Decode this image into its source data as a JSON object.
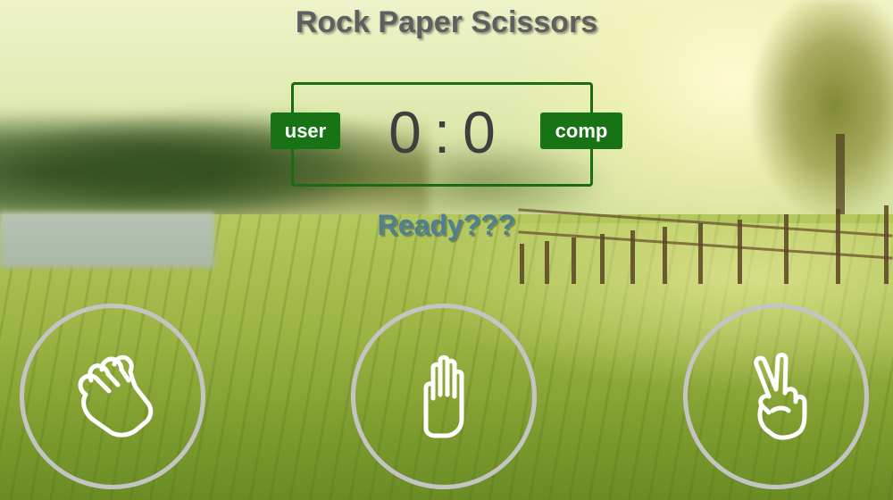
{
  "game": {
    "title": "Rock Paper Scissors"
  },
  "scoreboard": {
    "user_label": "user",
    "comp_label": "comp",
    "user_score": "0",
    "separator": ":",
    "comp_score": "0"
  },
  "status": {
    "message": "Ready???"
  },
  "choices": [
    {
      "id": "rock",
      "icon": "fist-icon"
    },
    {
      "id": "paper",
      "icon": "open-hand-icon"
    },
    {
      "id": "scissors",
      "icon": "peace-hand-icon"
    }
  ],
  "colors": {
    "badge_green": "#177314",
    "scoreboard_border": "#1a6b12",
    "title_gray": "#5f5f5f",
    "message_blue": "#4f7f93",
    "choice_ring": "#c4c4c4"
  }
}
